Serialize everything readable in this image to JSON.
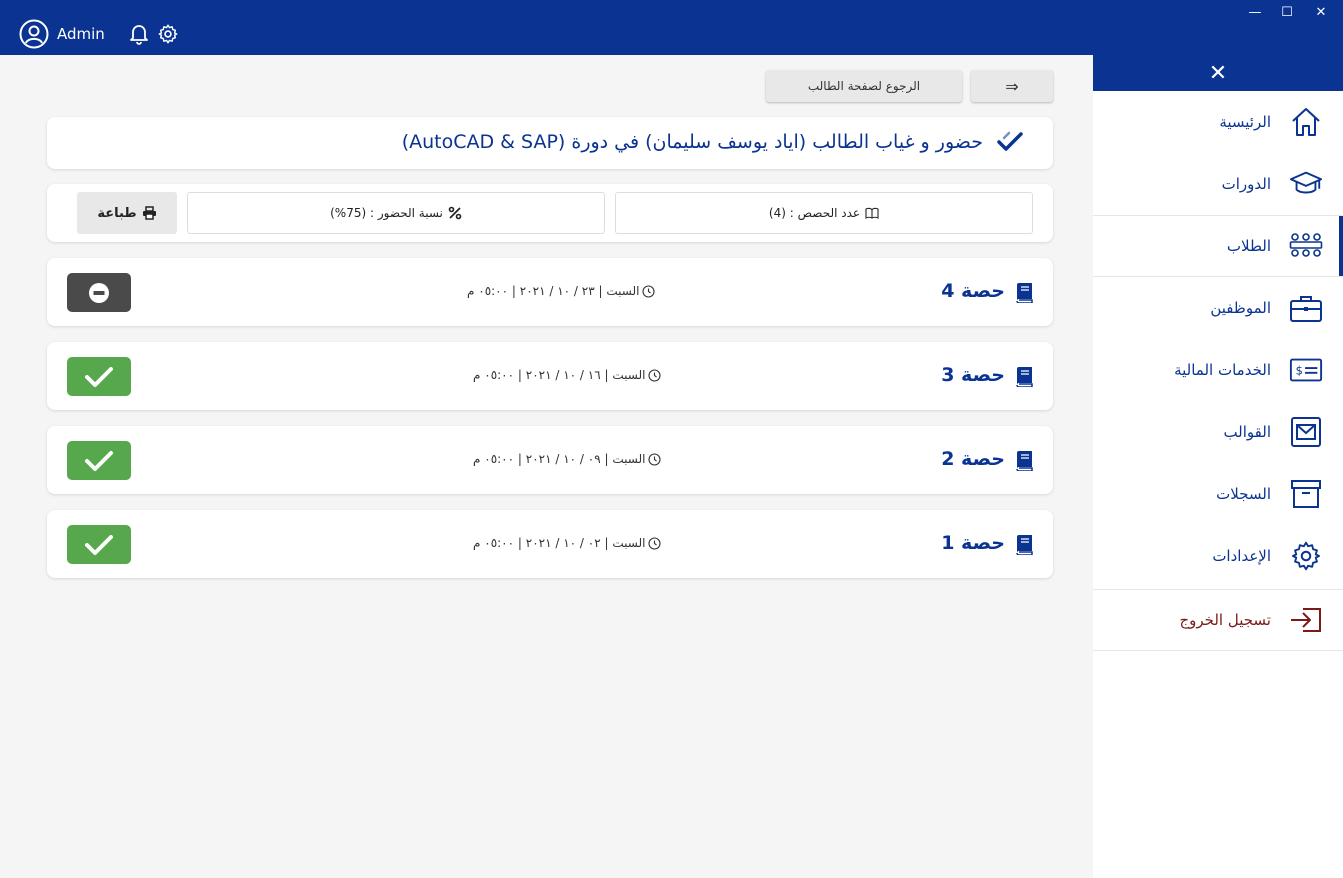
{
  "header": {
    "user_name": "Admin"
  },
  "window_controls": {
    "minimize": "—",
    "maximize": "☐",
    "close": "✕"
  },
  "sidebar": {
    "close_label": "✕",
    "items": [
      {
        "label": "الرئيسية",
        "icon": "home-icon"
      },
      {
        "label": "الدورات",
        "icon": "graduation-cap-icon"
      },
      {
        "label": "الطلاب",
        "icon": "users-icon",
        "active": true
      },
      {
        "label": "الموظفين",
        "icon": "briefcase-icon"
      },
      {
        "label": "الخدمات المالية",
        "icon": "money-card-icon"
      },
      {
        "label": "القوالب",
        "icon": "envelope-icon"
      },
      {
        "label": "السجلات",
        "icon": "archive-icon"
      },
      {
        "label": "الإعدادات",
        "icon": "gear-icon"
      },
      {
        "label": "تسجيل الخروج",
        "icon": "logout-icon"
      }
    ]
  },
  "toolbar": {
    "back_label": "الرجوع لصفحة الطالب",
    "arrow_label": "⇒"
  },
  "page": {
    "title": "حضور و غياب الطالب (اياد يوسف سليمان) في دورة (AutoCAD & SAP)"
  },
  "stats": {
    "sessions_count": "عدد الحصص : (4)",
    "attendance_rate": "نسبة الحضور : (75%)",
    "print_label": "طباعة"
  },
  "sessions": [
    {
      "title": "حصة 4",
      "date": "السبت | ٢٣ / ١٠ / ٢٠٢١ | ٠٥:٠٠ م",
      "status": "absent"
    },
    {
      "title": "حصة 3",
      "date": "السبت | ١٦ / ١٠ / ٢٠٢١ | ٠٥:٠٠ م",
      "status": "present"
    },
    {
      "title": "حصة 2",
      "date": "السبت | ٠٩ / ١٠ / ٢٠٢١ | ٠٥:٠٠ م",
      "status": "present"
    },
    {
      "title": "حصة 1",
      "date": "السبت | ٠٢ / ١٠ / ٢٠٢١ | ٠٥:٠٠ م",
      "status": "present"
    }
  ],
  "colors": {
    "brand": "#0b3391",
    "present": "#57a84d",
    "absent": "#4a4a4a",
    "logout": "#7a1a1a"
  }
}
